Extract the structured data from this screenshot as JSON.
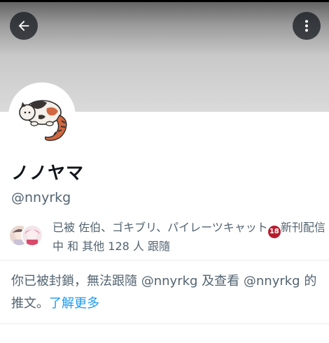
{
  "header": {
    "back_icon": "arrow-left-icon",
    "more_icon": "vertical-dots-icon"
  },
  "profile": {
    "avatar_icon": "cat-avatar-icon",
    "name": "ノノヤマ",
    "handle": "@nnyrkg"
  },
  "followers_you_know": {
    "text_before": "已被 佐伯、ゴキブリ、パイレーツキャット",
    "badge_icon": "no-minors-icon",
    "text_after": "新刊配信中 和 其他 128 人 跟隨"
  },
  "blocked_notice": {
    "text": "你已被封鎖，無法跟隨 @nnyrkg 及查看 @nnyrkg 的推文。",
    "learn_more": "了解更多"
  },
  "colors": {
    "link": "#1d9bf0",
    "secondary_text": "#536471",
    "button_bg": "#0f1419"
  }
}
